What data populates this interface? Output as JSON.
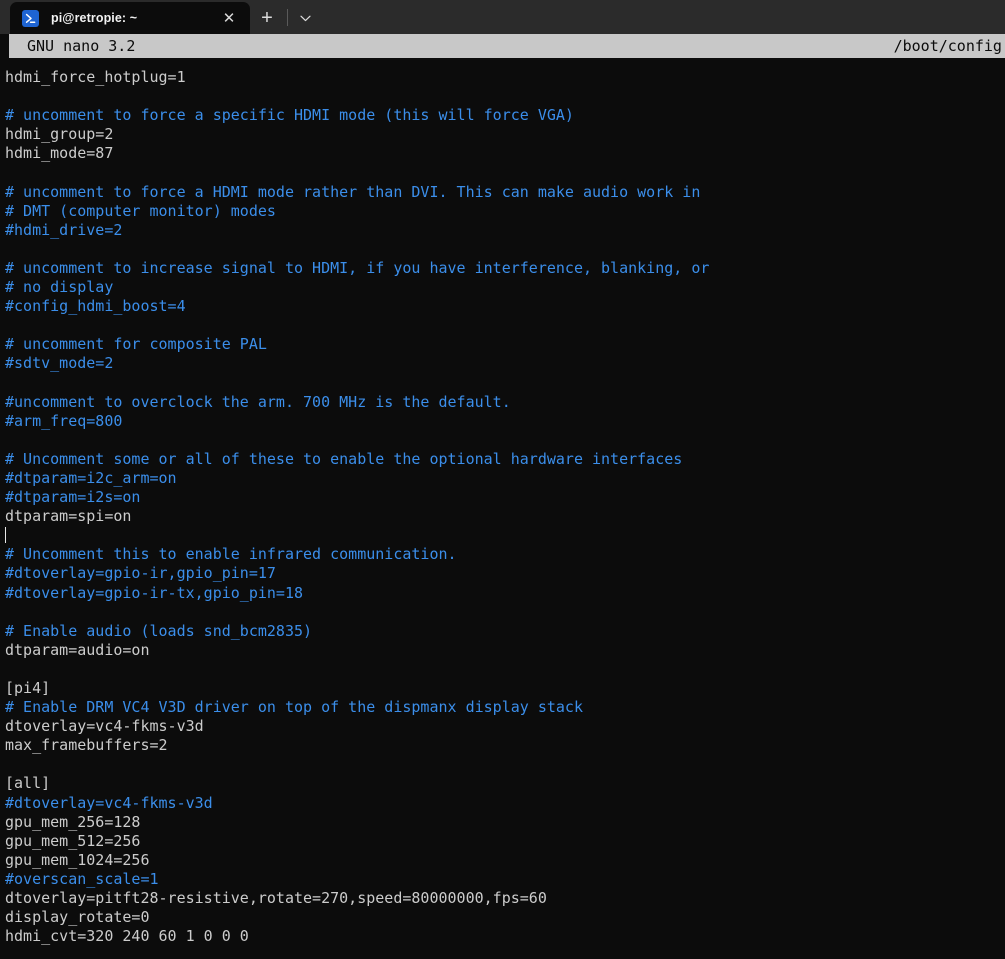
{
  "window": {
    "tab": {
      "icon": "powershell-prompt-icon",
      "title": "pi@retropie: ~",
      "close_label": "✕"
    },
    "new_tab_label": "+",
    "dropdown_label": "⌄"
  },
  "editor": {
    "version_label": "GNU nano 3.2",
    "filename": "/boot/config.",
    "colors": {
      "background": "#0c0c0c",
      "foreground": "#cccccc",
      "comment": "#3b8eea",
      "statusbar_bg": "#c8c8c8",
      "statusbar_fg": "#0c0c0c",
      "chrome_bg": "#2b2b2b",
      "tab_icon": "#1e64d2"
    },
    "cursor": {
      "line_index": 24,
      "column": 38
    },
    "lines": [
      {
        "text": "hdmi_force_hotplug=1",
        "kind": "code"
      },
      {
        "text": "",
        "kind": "blank"
      },
      {
        "text": "# uncomment to force a specific HDMI mode (this will force VGA)",
        "kind": "comment"
      },
      {
        "text": "hdmi_group=2",
        "kind": "code"
      },
      {
        "text": "hdmi_mode=87",
        "kind": "code"
      },
      {
        "text": "",
        "kind": "blank"
      },
      {
        "text": "# uncomment to force a HDMI mode rather than DVI. This can make audio work in",
        "kind": "comment"
      },
      {
        "text": "# DMT (computer monitor) modes",
        "kind": "comment"
      },
      {
        "text": "#hdmi_drive=2",
        "kind": "comment"
      },
      {
        "text": "",
        "kind": "blank"
      },
      {
        "text": "# uncomment to increase signal to HDMI, if you have interference, blanking, or",
        "kind": "comment"
      },
      {
        "text": "# no display",
        "kind": "comment"
      },
      {
        "text": "#config_hdmi_boost=4",
        "kind": "comment"
      },
      {
        "text": "",
        "kind": "blank"
      },
      {
        "text": "# uncomment for composite PAL",
        "kind": "comment"
      },
      {
        "text": "#sdtv_mode=2",
        "kind": "comment"
      },
      {
        "text": "",
        "kind": "blank"
      },
      {
        "text": "#uncomment to overclock the arm. 700 MHz is the default.",
        "kind": "comment"
      },
      {
        "text": "#arm_freq=800",
        "kind": "comment"
      },
      {
        "text": "",
        "kind": "blank"
      },
      {
        "text": "# Uncomment some or all of these to enable the optional hardware interfaces",
        "kind": "comment"
      },
      {
        "text": "#dtparam=i2c_arm=on",
        "kind": "comment"
      },
      {
        "text": "#dtparam=i2s=on",
        "kind": "comment"
      },
      {
        "text": "dtparam=spi=on",
        "kind": "code"
      },
      {
        "text": "",
        "kind": "blank"
      },
      {
        "text": "# Uncomment this to enable infrared communication.",
        "kind": "comment"
      },
      {
        "text": "#dtoverlay=gpio-ir,gpio_pin=17",
        "kind": "comment"
      },
      {
        "text": "#dtoverlay=gpio-ir-tx,gpio_pin=18",
        "kind": "comment"
      },
      {
        "text": "",
        "kind": "blank"
      },
      {
        "text": "# Enable audio (loads snd_bcm2835)",
        "kind": "comment"
      },
      {
        "text": "dtparam=audio=on",
        "kind": "code"
      },
      {
        "text": "",
        "kind": "blank"
      },
      {
        "text": "[pi4]",
        "kind": "code"
      },
      {
        "text": "# Enable DRM VC4 V3D driver on top of the dispmanx display stack",
        "kind": "comment"
      },
      {
        "text": "dtoverlay=vc4-fkms-v3d",
        "kind": "code"
      },
      {
        "text": "max_framebuffers=2",
        "kind": "code"
      },
      {
        "text": "",
        "kind": "blank"
      },
      {
        "text": "[all]",
        "kind": "code"
      },
      {
        "text": "#dtoverlay=vc4-fkms-v3d",
        "kind": "comment"
      },
      {
        "text": "gpu_mem_256=128",
        "kind": "code"
      },
      {
        "text": "gpu_mem_512=256",
        "kind": "code"
      },
      {
        "text": "gpu_mem_1024=256",
        "kind": "code"
      },
      {
        "text": "#overscan_scale=1",
        "kind": "comment"
      },
      {
        "text": "dtoverlay=pitft28-resistive,rotate=270,speed=80000000,fps=60",
        "kind": "code"
      },
      {
        "text": "display_rotate=0",
        "kind": "code"
      },
      {
        "text": "hdmi_cvt=320 240 60 1 0 0 0",
        "kind": "code"
      }
    ]
  }
}
